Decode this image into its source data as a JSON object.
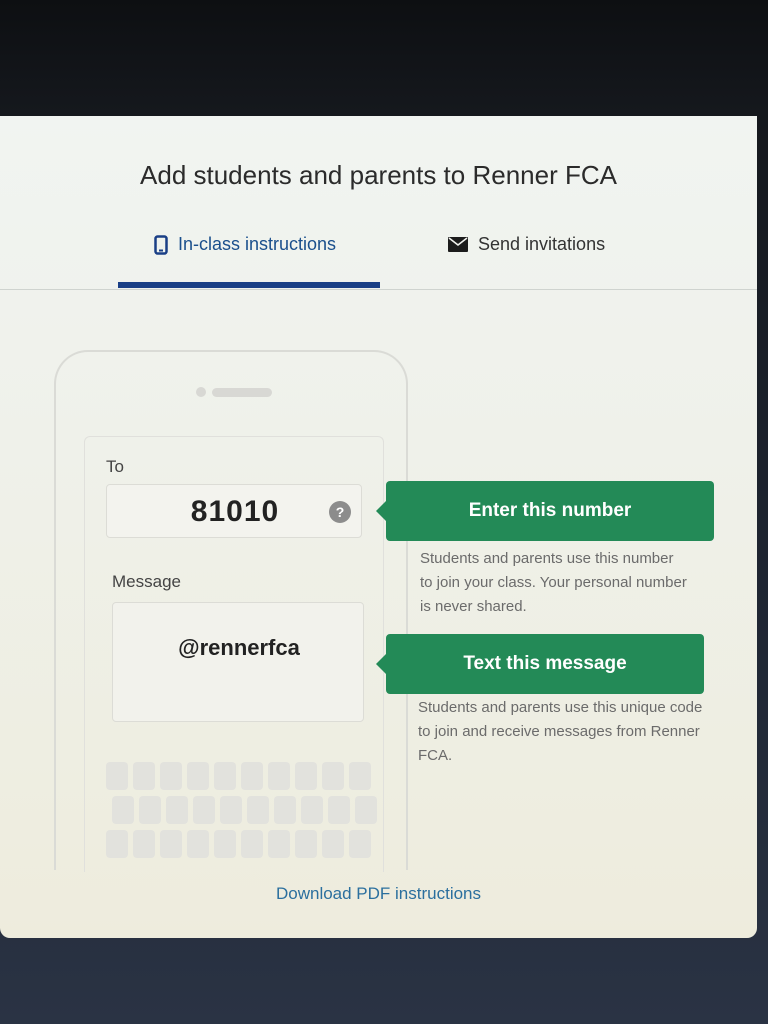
{
  "modal": {
    "title": "Add students and parents to Renner FCA"
  },
  "tabs": [
    {
      "label": "In-class instructions",
      "icon": "phone-icon",
      "active": true
    },
    {
      "label": "Send invitations",
      "icon": "envelope-icon",
      "active": false
    }
  ],
  "phone": {
    "to_label": "To",
    "to_number": "81010",
    "help_icon": "?",
    "message_label": "Message",
    "message_text": "@rennerfca"
  },
  "steps": [
    {
      "callout": "Enter this number",
      "description": "Students and parents use this number to join your class. Your personal number is never shared."
    },
    {
      "callout": "Text this message",
      "description": "Students and parents use this unique code to join and receive messages from Renner FCA."
    }
  ],
  "footer": {
    "download_link": "Download PDF instructions"
  },
  "colors": {
    "accent_blue": "#1a3f86",
    "callout_green": "#238a57",
    "link_blue": "#2b6f9e"
  }
}
